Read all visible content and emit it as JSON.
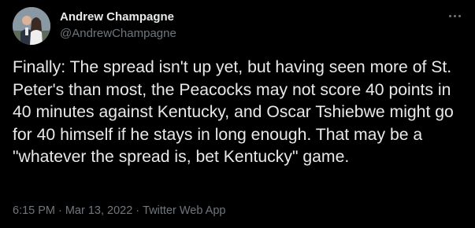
{
  "author": {
    "display_name": "Andrew Champagne",
    "handle": "@AndrewChampagne",
    "avatar_icon": "profile-photo"
  },
  "tweet": {
    "text": "Finally: The spread isn't up yet, but having seen more of St. Peter's than most, the Peacocks may not score 40 points in 40 minutes against Kentucky, and Oscar Tshiebwe might go for 40 himself if he stays in long enough. That may be a \"whatever the spread is, bet Kentucky\" game."
  },
  "meta": {
    "time": "6:15 PM",
    "separator": "·",
    "date": "Mar 13, 2022",
    "source": "Twitter Web App"
  },
  "more_icon": "more-horizontal-icon",
  "colors": {
    "background": "#000000",
    "primary_text": "#e7e9ea",
    "secondary_text": "#71767b"
  }
}
